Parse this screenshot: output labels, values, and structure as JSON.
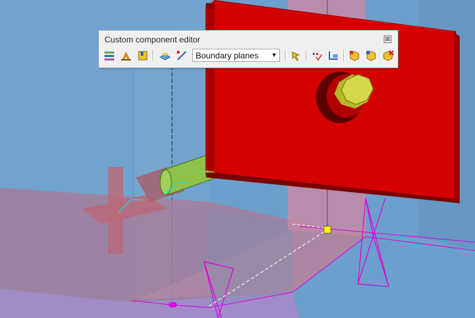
{
  "toolbar": {
    "title": "Custom component editor",
    "close_glyph": "⊠",
    "mode_select": {
      "value": "Boundary planes",
      "arrow": "▼"
    },
    "buttons": [
      "component-browser-icon",
      "create-variable-icon",
      "save-component-icon",
      "view-plane-icon",
      "snap-line-icon",
      "refresh-icon",
      "reference-point-icon",
      "reference-axis-icon",
      "add-component-icon",
      "modify-component-icon",
      "delete-component-icon"
    ]
  },
  "colors": {
    "background": "#6a9ec8",
    "plate_red": "#d40000",
    "rod_green": "#8fc24a",
    "bolt_yellow": "#d4d84a",
    "handle_magenta": "#e000e0",
    "handle_yellow": "#ffff00"
  }
}
